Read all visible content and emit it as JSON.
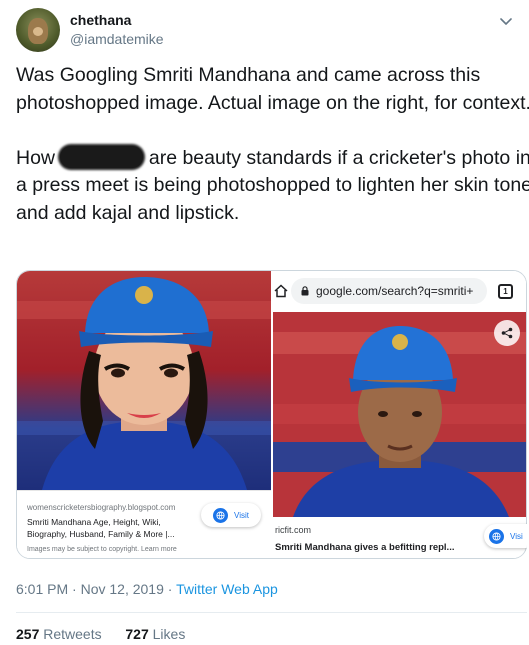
{
  "user": {
    "display_name": "chethana",
    "handle": "@iamdatemike"
  },
  "tweet": {
    "line1": "Was Googling Smriti Mandhana and came across this photoshopped image. Actual image on the right, for context.",
    "line2_before": "How ",
    "line2_after": " are beauty standards if a cricketer's photo in a press meet is being photoshopped to lighten her skin tone and add kajal and lipstick."
  },
  "left_result": {
    "source": "womenscricketersbiography.blogspot.com",
    "title": "Smriti Mandhana Age, Height, Wiki, Biography, Husband, Family & More |...",
    "copyright": "Images may be subject to copyright. Learn more",
    "visit_label": "Visit"
  },
  "right_result": {
    "url": "google.com/search?q=smriti+",
    "tab_count": "1",
    "source": "ricfit.com",
    "title": "Smriti Mandhana gives a befitting repl...",
    "visit_label": "Visi"
  },
  "meta": {
    "time": "6:01 PM",
    "date": "Nov 12, 2019",
    "app": "Twitter Web App"
  },
  "stats": {
    "retweets_count": "257",
    "retweets_label": "Retweets",
    "likes_count": "727",
    "likes_label": "Likes"
  },
  "colors": {
    "link": "#1b95e0",
    "google_blue": "#1a73e8",
    "text_primary": "#14171a",
    "text_secondary": "#657786",
    "cap_blue": "#1f6fd1",
    "jersey_blue": "#1b3c9e"
  }
}
